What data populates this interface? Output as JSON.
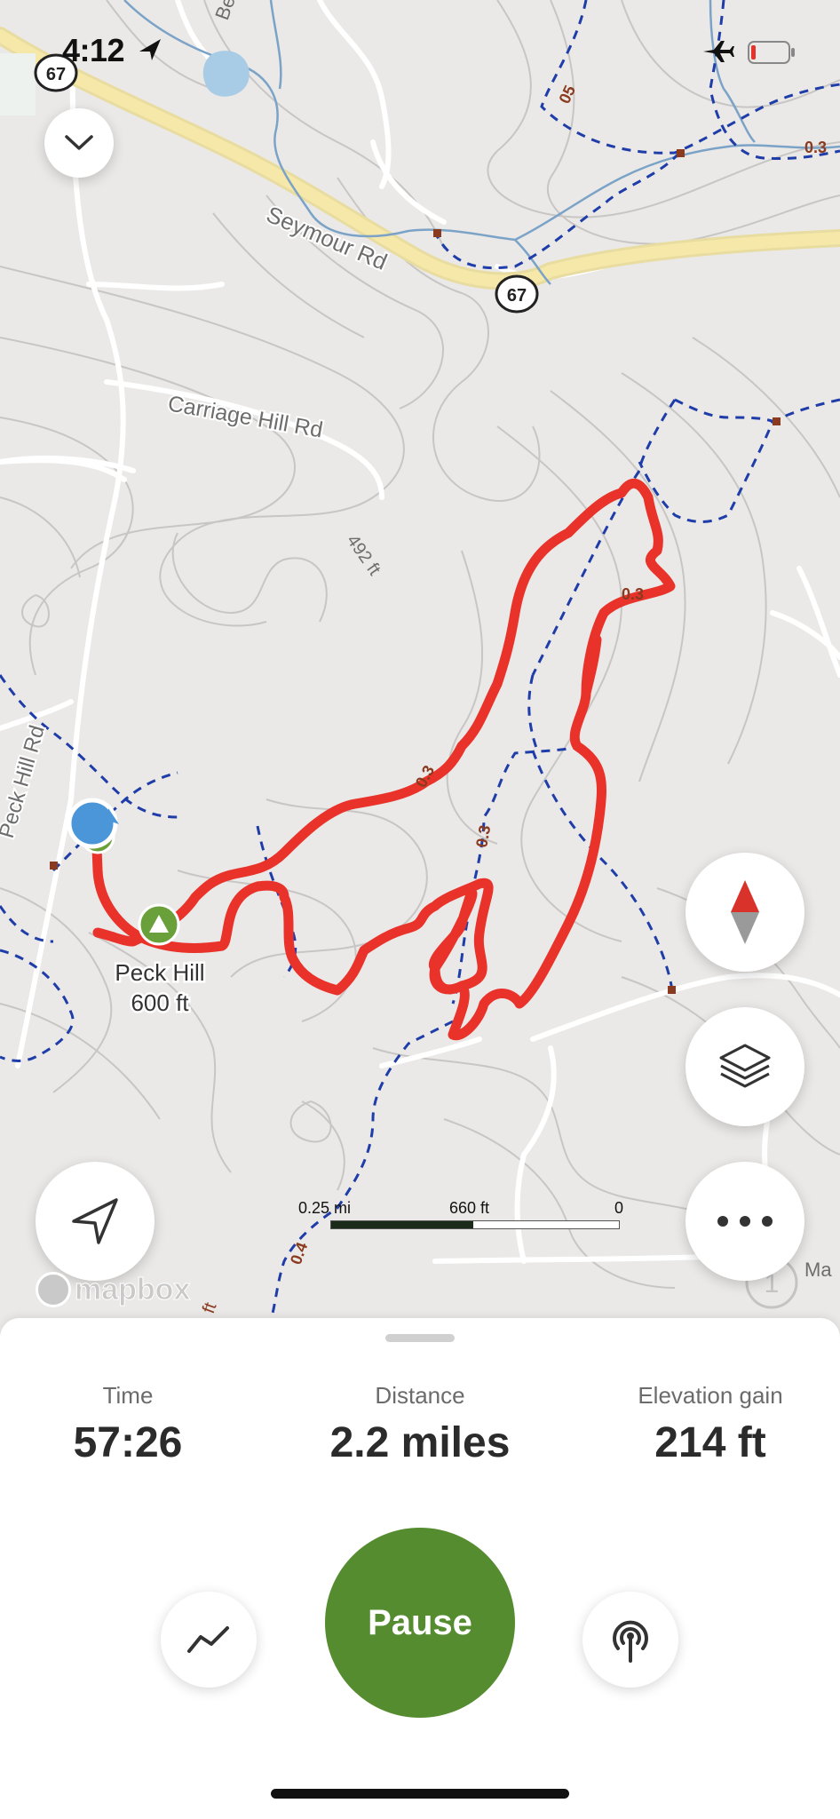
{
  "status_bar": {
    "time": "4:12",
    "location_icon": "location-arrow-icon",
    "airplane_icon": "airplane-icon",
    "battery_icon": "battery-low-icon"
  },
  "map": {
    "road_labels": {
      "seymour": "Seymour Rd",
      "carriage": "Carriage Hill Rd",
      "peck": "Peck Hill Rd",
      "route_67": "67"
    },
    "elevation_label": "492 ft",
    "peak": {
      "name": "Peck Hill",
      "elevation": "600 ft"
    },
    "trail_distance_labels": {
      "a": "05",
      "b": "0.3",
      "c": "0.3",
      "d": "0.3",
      "e": "0.3",
      "f": "0.4",
      "g": "0.3"
    },
    "partial_labels": {
      "be": "Be",
      "ma": "Ma",
      "ft": "ft",
      "one": "1"
    },
    "scale": {
      "left": "0.25 mi",
      "middle": "660 ft",
      "right": "0"
    },
    "attribution": "mapbox",
    "colors": {
      "track": "#e8322a",
      "trail": "#1f3da8",
      "stream": "#6d9cc4",
      "highway": "#f3e39b",
      "location": "#4a96d9",
      "peak_marker": "#6aa03a"
    }
  },
  "controls": {
    "collapse_icon": "chevron-down-icon",
    "compass_icon": "compass-icon",
    "layers_icon": "layers-icon",
    "more_icon": "more-icon",
    "locate_icon": "navigation-arrow-icon"
  },
  "stats": {
    "time": {
      "label": "Time",
      "value": "57:26"
    },
    "distance": {
      "label": "Distance",
      "value": "2.2 miles"
    },
    "elevation": {
      "label": "Elevation gain",
      "value": "214 ft"
    }
  },
  "actions": {
    "pause_label": "Pause",
    "chart_icon": "chart-icon",
    "beacon_icon": "beacon-icon",
    "accent": "#548c2f"
  }
}
